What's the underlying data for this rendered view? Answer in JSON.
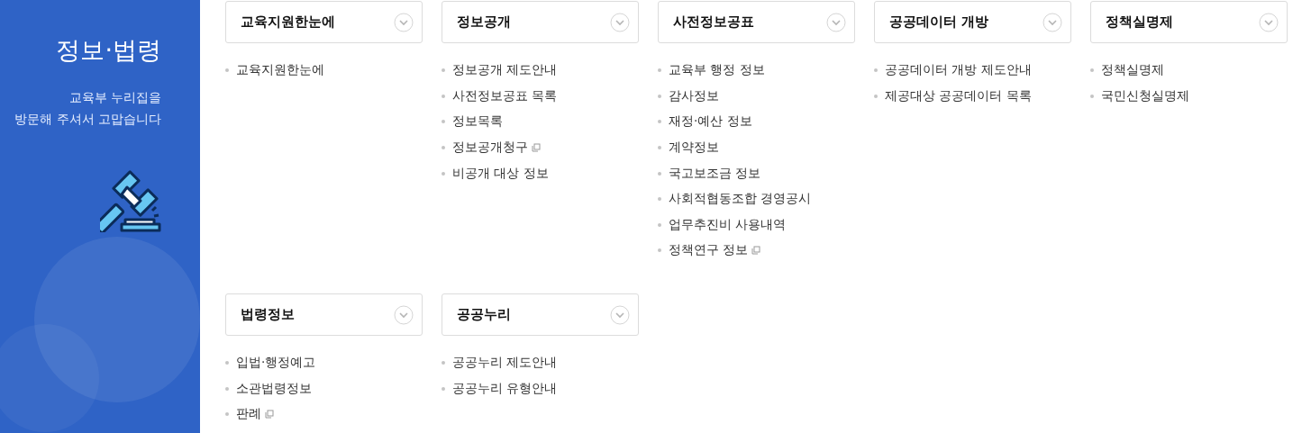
{
  "sidebar": {
    "title": "정보·법령",
    "greeting_lines": [
      "교육부 누리집을",
      "방문해 주셔서 고맙습니다"
    ]
  },
  "sections": [
    {
      "title": "교육지원한눈에",
      "expanded": false,
      "links": [
        {
          "label": "교육지원한눈에",
          "external": false
        }
      ]
    },
    {
      "title": "정보공개",
      "expanded": false,
      "links": [
        {
          "label": "정보공개 제도안내",
          "external": false
        },
        {
          "label": "사전정보공표 목록",
          "external": false
        },
        {
          "label": "정보목록",
          "external": false
        },
        {
          "label": "정보공개청구",
          "external": true
        },
        {
          "label": "비공개 대상 정보",
          "external": false
        }
      ]
    },
    {
      "title": "사전정보공표",
      "expanded": false,
      "links": [
        {
          "label": "교육부 행정 정보",
          "external": false
        },
        {
          "label": "감사정보",
          "external": false
        },
        {
          "label": "재정·예산 정보",
          "external": false
        },
        {
          "label": "계약정보",
          "external": false
        },
        {
          "label": "국고보조금 정보",
          "external": false
        },
        {
          "label": "사회적협동조합 경영공시",
          "external": false
        },
        {
          "label": "업무추진비 사용내역",
          "external": false
        },
        {
          "label": "정책연구 정보",
          "external": true
        }
      ]
    },
    {
      "title": "공공데이터 개방",
      "expanded": false,
      "links": [
        {
          "label": "공공데이터 개방 제도안내",
          "external": false
        },
        {
          "label": "제공대상 공공데이터 목록",
          "external": false
        }
      ]
    },
    {
      "title": "정책실명제",
      "expanded": false,
      "links": [
        {
          "label": "정책실명제",
          "external": false
        },
        {
          "label": "국민신청실명제",
          "external": false
        }
      ]
    },
    {
      "title": "법령정보",
      "expanded": false,
      "links": [
        {
          "label": "입법·행정예고",
          "external": false
        },
        {
          "label": "소관법령정보",
          "external": false
        },
        {
          "label": "판례",
          "external": true
        }
      ]
    },
    {
      "title": "공공누리",
      "expanded": false,
      "links": [
        {
          "label": "공공누리 제도안내",
          "external": false
        },
        {
          "label": "공공누리 유형안내",
          "external": false
        }
      ]
    }
  ]
}
